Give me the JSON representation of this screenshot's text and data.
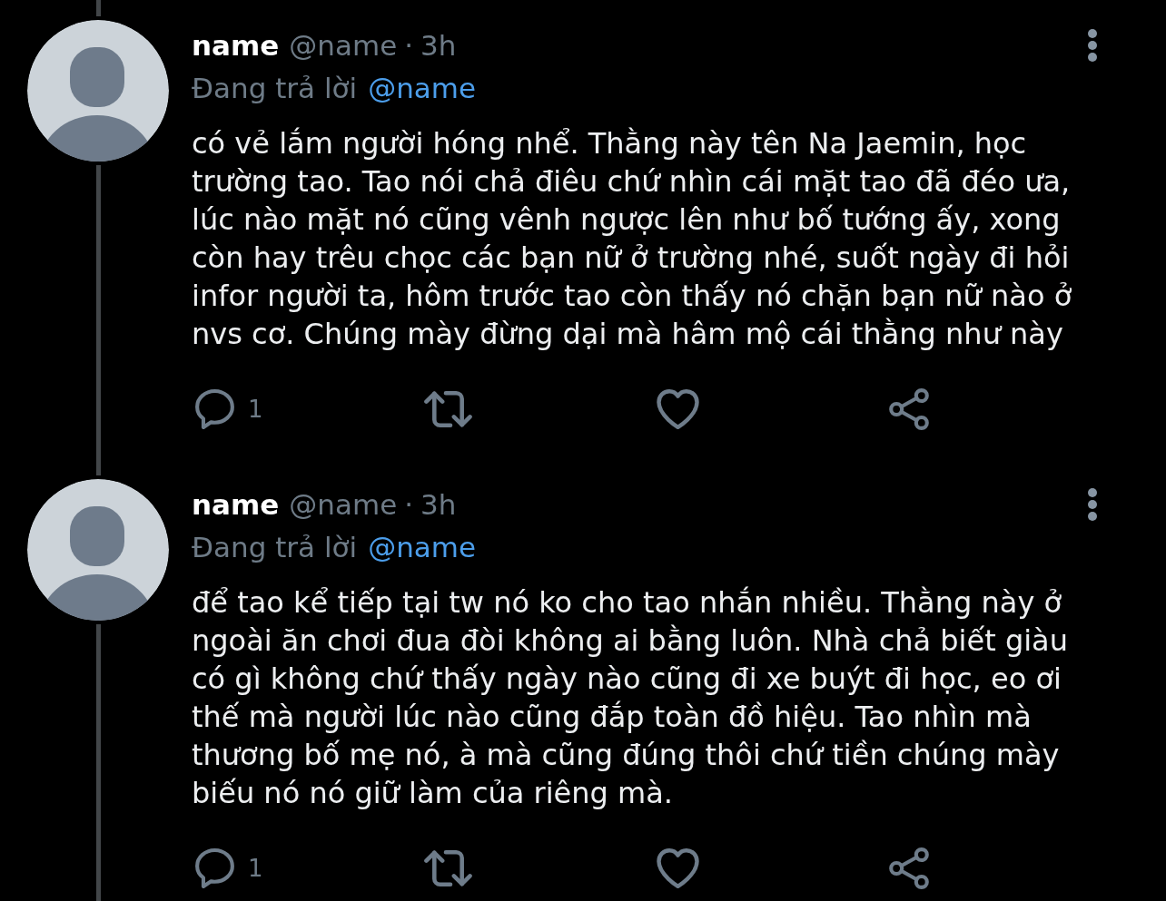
{
  "tweets": [
    {
      "author": {
        "name": "name",
        "handle": "@name",
        "separator": "·",
        "time": "3h"
      },
      "replying_to": {
        "label": "Đang trả lời",
        "handle": "@name"
      },
      "text": "có vẻ lắm người hóng nhể. Thằng này tên Na Jaemin, học\ntrường tao. Tao nói chả điêu chứ nhìn cái mặt tao đã đéo ưa,\nlúc nào mặt nó cũng vênh ngược lên như bố tướng ấy, xong\ncòn hay trêu chọc các bạn nữ ở trường nhé, suốt ngày đi hỏi\ninfor người ta, hôm trước tao còn thấy nó chặn bạn nữ nào ở\nnvs cơ. Chúng mày đừng dại mà hâm mộ cái thằng như này",
      "actions": [
        {
          "kind": "reply",
          "count": "1"
        },
        {
          "kind": "retweet"
        },
        {
          "kind": "like"
        },
        {
          "kind": "share"
        }
      ]
    },
    {
      "author": {
        "name": "name",
        "handle": "@name",
        "separator": "·",
        "time": "3h"
      },
      "replying_to": {
        "label": "Đang trả lời",
        "handle": "@name"
      },
      "text": "để tao kể tiếp tại tw nó ko cho tao nhắn nhiều. Thằng này ở\nngoài ăn chơi đua đòi không ai bằng luôn. Nhà chả biết giàu\ncó gì không chứ thấy ngày nào cũng đi xe buýt đi học, eo ơi\nthế mà người lúc nào cũng đắp toàn đồ hiệu. Tao nhìn mà\nthương bố mẹ nó, à mà cũng đúng thôi chứ tiền chúng mày\nbiếu nó nó giữ làm của riêng mà.",
      "actions": [
        {
          "kind": "reply",
          "count": "1"
        },
        {
          "kind": "retweet"
        },
        {
          "kind": "like"
        },
        {
          "kind": "share"
        }
      ]
    }
  ]
}
